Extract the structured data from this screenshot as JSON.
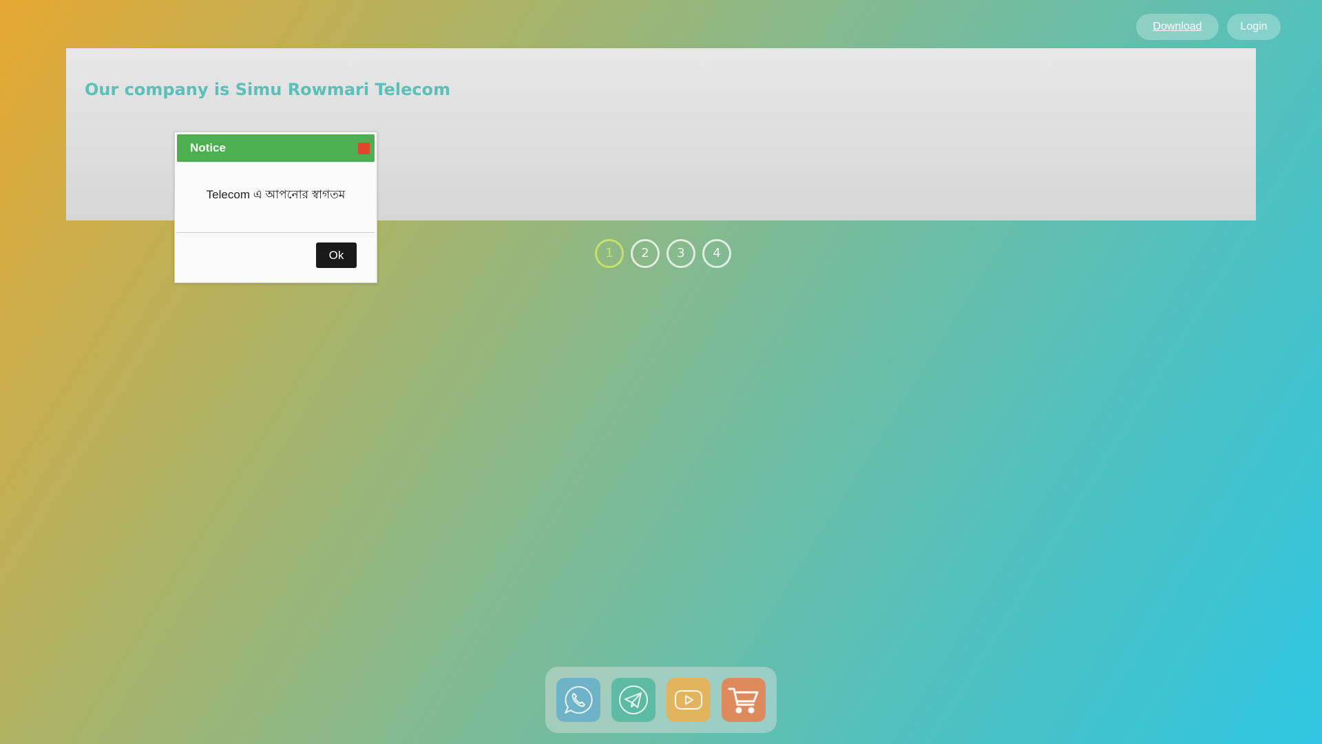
{
  "header": {
    "download_label": "Download",
    "login_label": "Login"
  },
  "banner": {
    "title": "Our company is Simu Rowmari Telecom"
  },
  "slider": {
    "dots": [
      "1",
      "2",
      "3",
      "4"
    ],
    "active_index": 0
  },
  "dialog": {
    "title": "Notice",
    "message": "Telecom এ আপনোর স্বাগতম",
    "ok_label": "Ok"
  },
  "dock": {
    "items": [
      {
        "icon": "whatsapp-icon",
        "color": "#6fb3c8"
      },
      {
        "icon": "telegram-icon",
        "color": "#5dbba3"
      },
      {
        "icon": "youtube-icon",
        "color": "#e3b45e"
      },
      {
        "icon": "shopping-cart-icon",
        "color": "#df8a5c"
      }
    ]
  },
  "colors": {
    "accent_title": "#5cbfb8",
    "dialog_header": "#4caf50",
    "close_button": "#e2462a",
    "active_dot": "#c9e068"
  }
}
